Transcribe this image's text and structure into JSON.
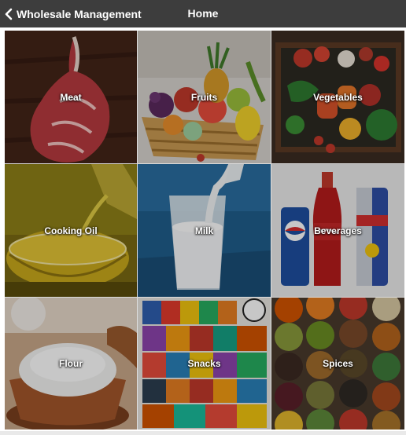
{
  "header": {
    "back_label": "Wholesale Management",
    "title": "Home",
    "back_icon": "chevron-left-icon",
    "background": "#3d3d3d"
  },
  "categories": [
    {
      "label": "Meat"
    },
    {
      "label": "Fruits"
    },
    {
      "label": "Vegetables"
    },
    {
      "label": "Cooking Oil"
    },
    {
      "label": "Milk"
    },
    {
      "label": "Beverages"
    },
    {
      "label": "Flour"
    },
    {
      "label": "Snacks"
    },
    {
      "label": "Spices"
    }
  ]
}
